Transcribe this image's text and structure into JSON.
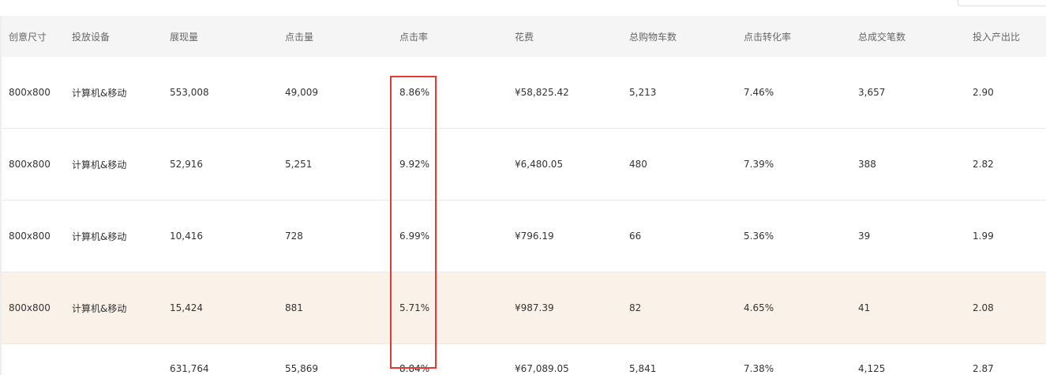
{
  "table": {
    "columns": [
      "创意尺寸",
      "投放设备",
      "展现量",
      "点击量",
      "点击率",
      "花费",
      "总购物车数",
      "点击转化率",
      "总成交笔数",
      "投入产出比"
    ],
    "rows": [
      [
        "800x800",
        "计算机&移动",
        "553,008",
        "49,009",
        "8.86%",
        "¥58,825.42",
        "5,213",
        "7.46%",
        "3,657",
        "2.90"
      ],
      [
        "800x800",
        "计算机&移动",
        "52,916",
        "5,251",
        "9.92%",
        "¥6,480.05",
        "480",
        "7.39%",
        "388",
        "2.82"
      ],
      [
        "800x800",
        "计算机&移动",
        "10,416",
        "728",
        "6.99%",
        "¥796.19",
        "66",
        "5.36%",
        "39",
        "1.99"
      ],
      [
        "800x800",
        "计算机&移动",
        "15,424",
        "881",
        "5.71%",
        "¥987.39",
        "82",
        "4.65%",
        "41",
        "2.08"
      ]
    ],
    "totals": [
      "",
      "",
      "631,764",
      "55,869",
      "8.84%",
      "¥67,089.05",
      "5,841",
      "7.38%",
      "4,125",
      "2.87"
    ]
  },
  "colors": {
    "header_bg": "#f5f5f5",
    "highlight_row_bg": "#faf2e9",
    "annotation_box": "#e53935"
  }
}
